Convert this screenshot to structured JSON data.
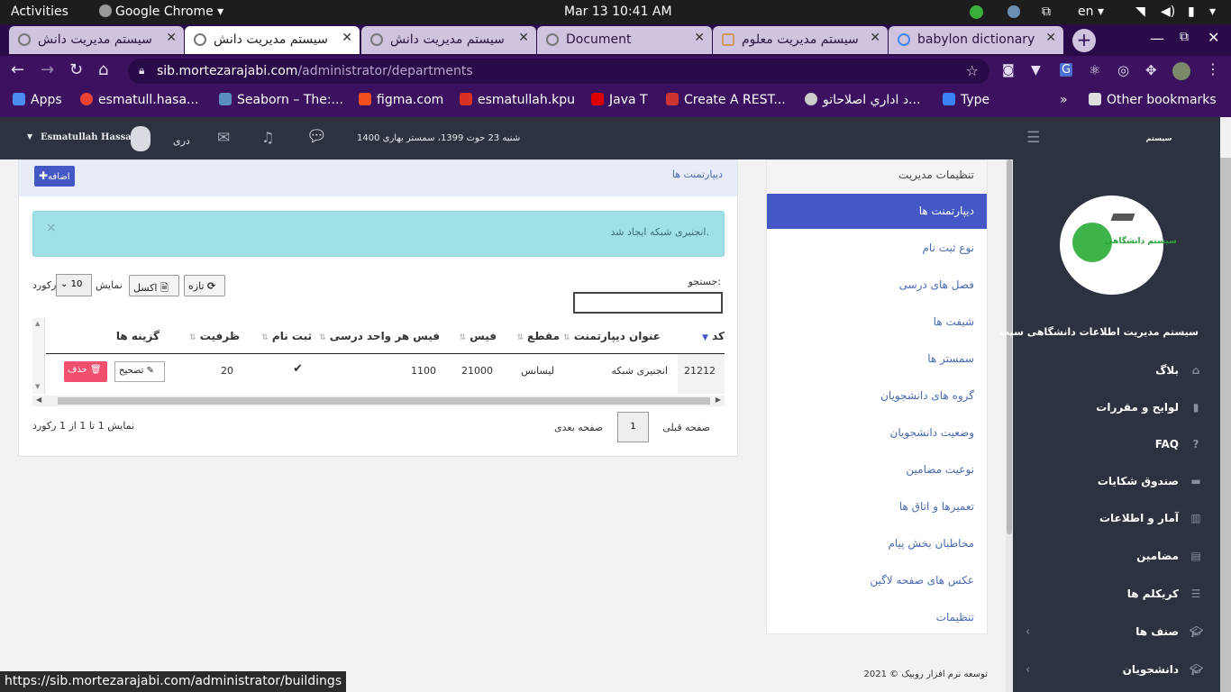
{
  "system": {
    "activities": "Activities",
    "app_name": "Google Chrome",
    "datetime": "Mar 13  10:41 AM",
    "lang": "en"
  },
  "tabs": [
    {
      "label": "سیستم مدیریت دانش"
    },
    {
      "label": "سیستم مدیریت دانش"
    },
    {
      "label": "سیستم مدیریت دانش"
    },
    {
      "label": "Document"
    },
    {
      "label": "سیستم مدیریت معلوم"
    },
    {
      "label": "babylon dictionary"
    }
  ],
  "address": {
    "domain": "sib.mortezarajabi.com",
    "path": "/administrator/departments"
  },
  "bookmarks": [
    {
      "label": "Apps",
      "color": "#4a8cf0"
    },
    {
      "label": "esmatull.hasa...",
      "color": "#ea4335"
    },
    {
      "label": "Seaborn – The:...",
      "color": "#5a8fc0"
    },
    {
      "label": "figma.com",
      "color": "#f24e1e"
    },
    {
      "label": "esmatullah.kpu",
      "color": "#d93025"
    },
    {
      "label": "Java T",
      "color": "#d00"
    },
    {
      "label": "Create A REST...",
      "color": "#c33"
    },
    {
      "label": "د اداري اصلاحاتو...",
      "color": "#ccc"
    },
    {
      "label": "Type",
      "color": "#3b82f6"
    },
    {
      "label": "Other bookmarks",
      "color": "#ddd"
    }
  ],
  "header": {
    "user": "Esmatullah Hassani",
    "language": "دری",
    "date_text": "شنبه 23 حوت 1399، سمستر بهاری 1400",
    "logo_alt": "سیستم دانشگاهی"
  },
  "panel": {
    "title": "دیپارتمنت ها",
    "add_label": "اضافه",
    "alert_text": "انجنیری شبکه ایجاد شد.",
    "search_label": "جستجو:",
    "search_value": "",
    "show_label": "نمایش",
    "page_size": "10",
    "records_label": "رکورد",
    "excel_label": "اکسل",
    "refresh_label": "تازه",
    "columns": [
      "کد",
      "عنوان دیپارتمنت",
      "مقطع",
      "فیس",
      "فیس هر واحد درسی",
      "ثبت نام",
      "ظرفیت",
      "گزینه ها"
    ],
    "rows": [
      {
        "code": "21212",
        "title": "انجنیری شبکه",
        "level": "لیسانس",
        "fee": "21000",
        "unit_fee": "1100",
        "registration": "✔",
        "capacity": "20"
      }
    ],
    "edit_label": "تصحیح",
    "delete_label": "حذف",
    "prev_label": "صفحه قبلی",
    "page_number": "1",
    "next_label": "صفحه بعدی",
    "info_text": "نمایش 1 تا 1 از 1 رکورد"
  },
  "side_menu": {
    "heading": "تنظیمات مدیریت",
    "items": [
      "دیپارتمنت ها",
      "نوع ثبت نام",
      "فصل های درسی",
      "شیفت ها",
      "سمستر ها",
      "گروه های دانشجویان",
      "وضعیت دانشجویان",
      "نوعیت مضامین",
      "تعمیرها و اتاق ها",
      "مخاطبان بخش پیام",
      "عکس های صفحه لاگین",
      "تنظیمات"
    ]
  },
  "dark_sidebar": {
    "system_title": "سیستم مدیریت اطلاعات دانشگاهی سیب",
    "items": [
      {
        "label": "بلاگ",
        "icon": "home-icon"
      },
      {
        "label": "لوایح و مقررات",
        "icon": "bookmark-icon"
      },
      {
        "label": "FAQ",
        "icon": "question-icon"
      },
      {
        "label": "صندوق شکایات",
        "icon": "inbox-icon"
      },
      {
        "label": "آمار و اطلاعات",
        "icon": "chart-icon"
      },
      {
        "label": "مضامین",
        "icon": "book-icon"
      },
      {
        "label": "کریکلم ها",
        "icon": "list-icon"
      },
      {
        "label": "صنف ها",
        "icon": "graduation-icon"
      },
      {
        "label": "دانشجویان",
        "icon": "graduation-icon"
      }
    ]
  },
  "footer": {
    "copyright": "2021 © توسعه نرم افزار روبیک"
  },
  "status_url": "https://sib.mortezarajabi.com/administrator/buildings",
  "colors": {
    "accent": "#4358c4",
    "danger": "#f0506e",
    "alert_bg": "#9fe1e6"
  }
}
